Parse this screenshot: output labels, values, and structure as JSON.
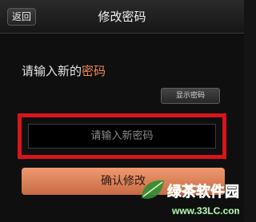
{
  "header": {
    "back_label": "返回",
    "title": "修改密码"
  },
  "form": {
    "prompt_plain": "请输入新的",
    "prompt_accent": "密码",
    "show_password_label": "显示密码",
    "password_placeholder": "请输入新密码",
    "confirm_label": "确认修改"
  },
  "watermark": {
    "brand": "绿茶软件园",
    "url": "www.33LC.com"
  },
  "colors": {
    "accent": "#f08a5a",
    "highlight": "#d8141c",
    "watermark_green": "#2f8f2f"
  }
}
